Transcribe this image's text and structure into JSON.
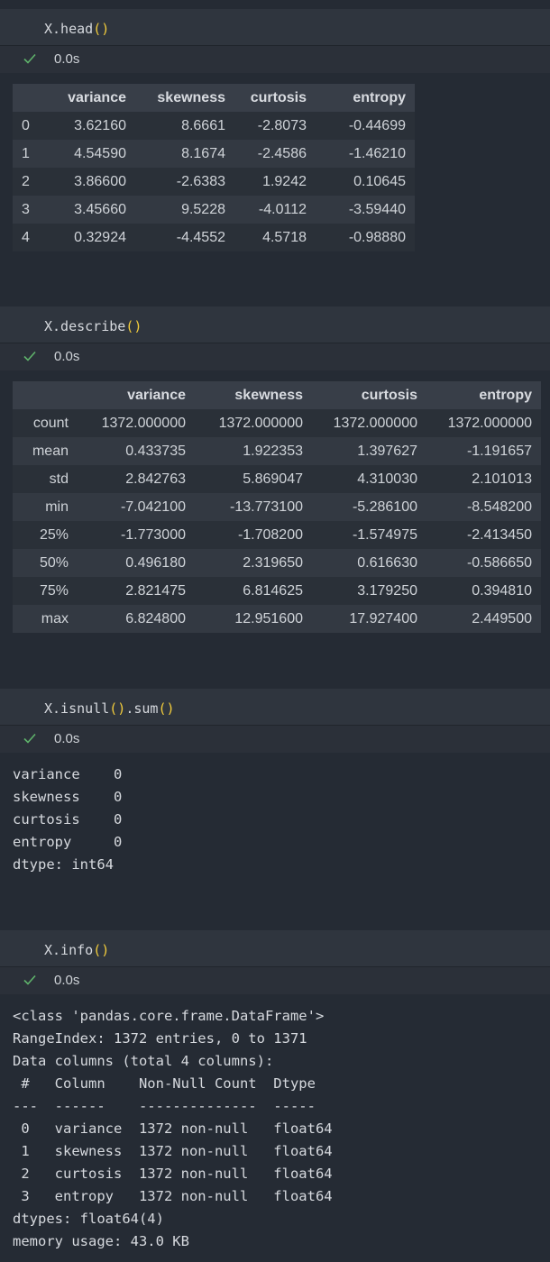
{
  "cells": [
    {
      "code": {
        "name": "X.head",
        "open": "(",
        "close": ")"
      },
      "time": "0.0s",
      "table": {
        "headers": [
          "",
          "variance",
          "skewness",
          "curtosis",
          "entropy"
        ],
        "rows": [
          [
            "0",
            "3.62160",
            "8.6661",
            "-2.8073",
            "-0.44699"
          ],
          [
            "1",
            "4.54590",
            "8.1674",
            "-2.4586",
            "-1.46210"
          ],
          [
            "2",
            "3.86600",
            "-2.6383",
            "1.9242",
            "0.10645"
          ],
          [
            "3",
            "3.45660",
            "9.5228",
            "-4.0112",
            "-3.59440"
          ],
          [
            "4",
            "0.32924",
            "-4.4552",
            "4.5718",
            "-0.98880"
          ]
        ]
      }
    },
    {
      "code": {
        "name": "X.describe",
        "open": "(",
        "close": ")"
      },
      "time": "0.0s",
      "table": {
        "headers": [
          "",
          "variance",
          "skewness",
          "curtosis",
          "entropy"
        ],
        "rows": [
          [
            "count",
            "1372.000000",
            "1372.000000",
            "1372.000000",
            "1372.000000"
          ],
          [
            "mean",
            "0.433735",
            "1.922353",
            "1.397627",
            "-1.191657"
          ],
          [
            "std",
            "2.842763",
            "5.869047",
            "4.310030",
            "2.101013"
          ],
          [
            "min",
            "-7.042100",
            "-13.773100",
            "-5.286100",
            "-8.548200"
          ],
          [
            "25%",
            "-1.773000",
            "-1.708200",
            "-1.574975",
            "-2.413450"
          ],
          [
            "50%",
            "0.496180",
            "2.319650",
            "0.616630",
            "-0.586650"
          ],
          [
            "75%",
            "2.821475",
            "6.814625",
            "3.179250",
            "0.394810"
          ],
          [
            "max",
            "6.824800",
            "12.951600",
            "17.927400",
            "2.449500"
          ]
        ]
      }
    },
    {
      "code": {
        "part1": "X.isnull",
        "part2": ".sum",
        "open": "(",
        "close": ")"
      },
      "time": "0.0s",
      "output": "variance    0\nskewness    0\ncurtosis    0\nentropy     0\ndtype: int64"
    },
    {
      "code": {
        "name": "X.info",
        "open": "(",
        "close": ")"
      },
      "time": "0.0s",
      "output": "<class 'pandas.core.frame.DataFrame'>\nRangeIndex: 1372 entries, 0 to 1371\nData columns (total 4 columns):\n #   Column    Non-Null Count  Dtype  \n---  ------    --------------  -----  \n 0   variance  1372 non-null   float64\n 1   skewness  1372 non-null   float64\n 2   curtosis  1372 non-null   float64\n 3   entropy   1372 non-null   float64\ndtypes: float64(4)\nmemory usage: 43.0 KB"
    }
  ],
  "colors": {
    "background": "#252b34",
    "input_bar": "#2f353e",
    "paren": "#f2cc3c",
    "check": "#5fb36b"
  },
  "icons": {
    "status": "check-icon"
  }
}
